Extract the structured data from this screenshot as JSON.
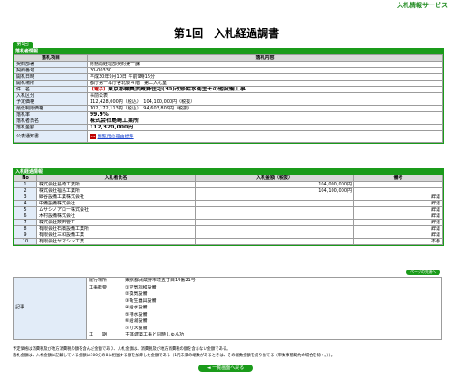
{
  "service_name": "入札情報サービス",
  "title": "第1回　入札経過調書",
  "round_tab": "第1回",
  "info_section": {
    "heading": "落札者情報",
    "col_item": "落札項目",
    "col_content": "落札内容",
    "rows": [
      {
        "label": "契約部署",
        "value": "財務局経理部契約第一課"
      },
      {
        "label": "契約番号",
        "value": "30-00330"
      },
      {
        "label": "開札日時",
        "value": "平成30年9月10日 午前9時15分"
      },
      {
        "label": "開札場所",
        "value": "都庁第一本庁舎北側４階　第二入札室"
      },
      {
        "label": "件　名",
        "tag": "【電子】",
        "value": "東京都職員武蔵野住宅(30)改修給水衛生その他設備工事"
      },
      {
        "label": "入札区分",
        "value": "事前公表"
      },
      {
        "label": "予定価格",
        "value": "112,428,000円（税込）　104,100,000円（税抜）"
      },
      {
        "label": "最低制限価格",
        "value": "102,172,113円（税込）　94,603,809円（税抜）"
      },
      {
        "label": "落札率",
        "value": "99.9%"
      },
      {
        "label": "落札者氏名",
        "value": "株式会社島崎工業所"
      },
      {
        "label": "落札金額",
        "value": "112,320,000円"
      }
    ],
    "notice_label": "公表通知書",
    "notice_icon": "pdf-icon",
    "notice_link": "閲覧用の理由標準"
  },
  "bid_section": {
    "heading": "入札経過情報",
    "col_no": "No",
    "col_name": "入札者氏名",
    "col_amount": "入札金額（税抜）",
    "col_note": "備考",
    "bids": [
      {
        "no": "1",
        "name": "株式会社島崎工業所",
        "amount": "104,000,000円",
        "note": ""
      },
      {
        "no": "2",
        "name": "株式会社福島工業所",
        "amount": "104,100,000円",
        "note": ""
      },
      {
        "no": "3",
        "name": "細谷設備工業株式会社",
        "amount": "",
        "note": "辞退"
      },
      {
        "no": "4",
        "name": "中備設備株式会社",
        "amount": "",
        "note": "辞退"
      },
      {
        "no": "5",
        "name": "ムサシノアロー株式会社",
        "amount": "",
        "note": "辞退"
      },
      {
        "no": "6",
        "name": "木村設備株式会社",
        "amount": "",
        "note": "辞退"
      },
      {
        "no": "7",
        "name": "株式会社数田管工",
        "amount": "",
        "note": "辞退"
      },
      {
        "no": "8",
        "name": "有限会社石橋設備工業所",
        "amount": "",
        "note": "辞退"
      },
      {
        "no": "9",
        "name": "有限会社三和設備工業",
        "amount": "",
        "note": "辞退"
      },
      {
        "no": "10",
        "name": "有限会社ヤマシン工業",
        "amount": "",
        "note": "不参"
      }
    ],
    "page_top_button": "ページの先頭へ"
  },
  "memo": {
    "label": "記事",
    "lines": [
      {
        "k": "履行場所",
        "v": "東京都武蔵野市境五丁目14番21号"
      },
      {
        "k": "工事概要",
        "v": "①空気調和設備"
      },
      {
        "k": "",
        "v": "②換気設備"
      },
      {
        "k": "",
        "v": "③衛生器具設備"
      },
      {
        "k": "",
        "v": "④給水設備"
      },
      {
        "k": "",
        "v": "⑤排水設備"
      },
      {
        "k": "",
        "v": "⑥給湯設備"
      },
      {
        "k": "",
        "v": "⑦ガス設備"
      },
      {
        "k": "工　　期",
        "v": "主体建築工事と同時しゅん功"
      }
    ]
  },
  "footnotes": [
    "予定価格は消費税及び地方消費税の額を含んだ金額であり、入札金額は、消費税及び地方消費税の額を含まない金額である。",
    "落札金額は、入札金額に記載している金額に100分の8に相当する額を加算した金額である（1円未満の端数があるときは、その端数金額を切り捨てる（単数事態契約の場合を除く。））。"
  ],
  "back_button": "一覧画面へ戻る"
}
